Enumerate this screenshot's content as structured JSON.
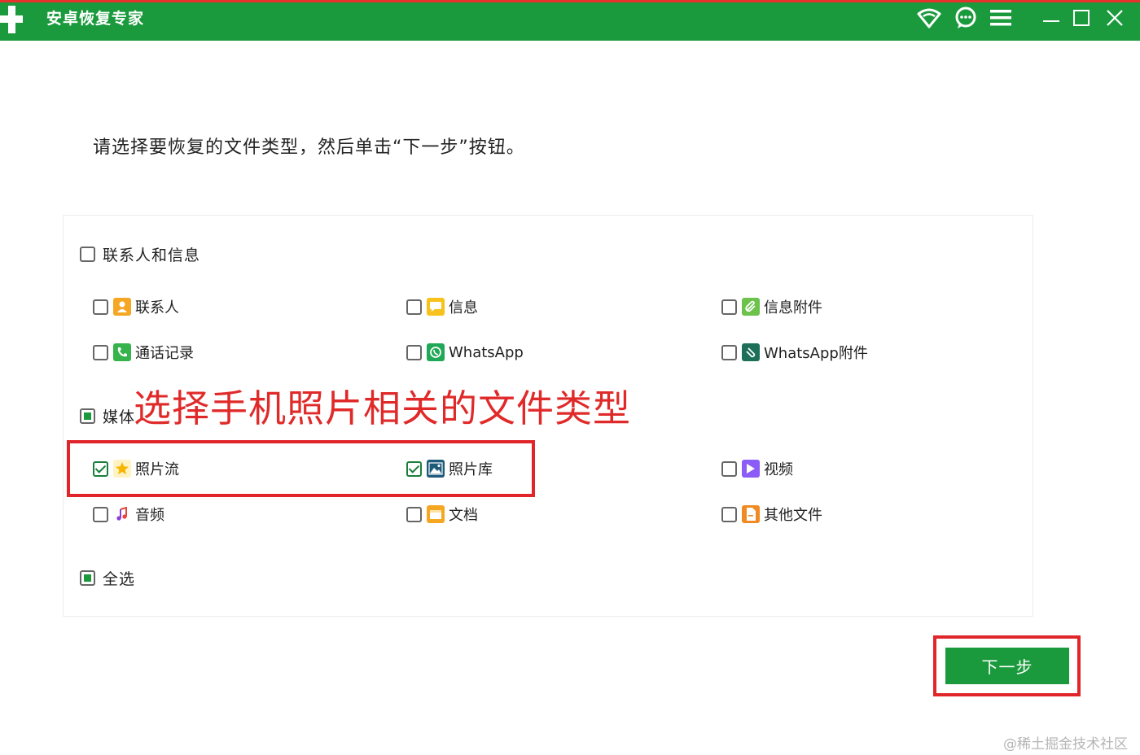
{
  "window": {
    "title": "安卓恢复专家",
    "icons": [
      "wifi-icon",
      "chat-icon",
      "menu-icon",
      "minimize-icon",
      "maximize-icon",
      "close-icon"
    ]
  },
  "instruction": "请选择要恢复的文件类型，然后单击“下一步”按钮。",
  "groups": {
    "contacts": {
      "label": "联系人和信息",
      "state": "unchecked",
      "items": [
        {
          "label": "联系人",
          "icon": "contact-icon",
          "color": "#f5a623",
          "checked": false
        },
        {
          "label": "信息",
          "icon": "message-icon",
          "color": "#f7c21b",
          "checked": false
        },
        {
          "label": "信息附件",
          "icon": "attachment-icon",
          "color": "#6cc24a",
          "checked": false
        },
        {
          "label": "通话记录",
          "icon": "phone-icon",
          "color": "#36b34a",
          "checked": false
        },
        {
          "label": "WhatsApp",
          "icon": "whatsapp-icon",
          "color": "#1fa855",
          "checked": false
        },
        {
          "label": "WhatsApp附件",
          "icon": "whatsapp-attachment-icon",
          "color": "#1d6f5a",
          "checked": false
        }
      ]
    },
    "media": {
      "label": "媒体",
      "state": "partial",
      "items": [
        {
          "label": "照片流",
          "icon": "star-icon",
          "color": "#f7b500",
          "checked": true
        },
        {
          "label": "照片库",
          "icon": "image-icon",
          "color": "#1e5a7a",
          "checked": true
        },
        {
          "label": "视频",
          "icon": "video-icon",
          "color": "#8b5cf6",
          "checked": false
        },
        {
          "label": "音频",
          "icon": "music-icon",
          "color": "#e8453c",
          "checked": false
        },
        {
          "label": "文档",
          "icon": "folder-icon",
          "color": "#f5a623",
          "checked": false
        },
        {
          "label": "其他文件",
          "icon": "file-icon",
          "color": "#f08a24",
          "checked": false
        }
      ]
    }
  },
  "select_all": {
    "label": "全选",
    "state": "partial"
  },
  "annotation": "选择手机照片相关的文件类型",
  "next_button": "下一步",
  "watermark": "@稀土掘金技术社区",
  "colors": {
    "brand": "#1a9a3c",
    "highlight": "#e0262a",
    "annotation": "#e02a2a"
  }
}
